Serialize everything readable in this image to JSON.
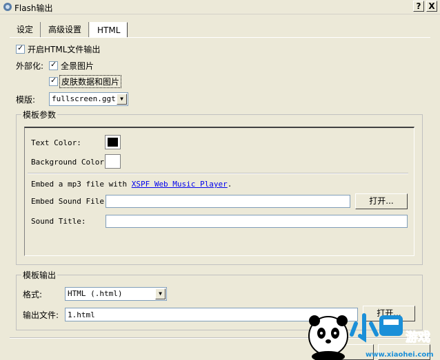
{
  "window": {
    "title": "Flash输出",
    "help_label": "?",
    "close_label": "X"
  },
  "tabs": [
    {
      "label": "设定"
    },
    {
      "label": "高级设置"
    },
    {
      "label": "HTML"
    }
  ],
  "options": {
    "enable_html": {
      "label": "开启HTML文件输出",
      "checked": true
    },
    "externalize": {
      "label": "外部化:"
    },
    "panorama": {
      "label": "全景图片",
      "checked": true
    },
    "skin": {
      "label": "皮肤数据和图片",
      "checked": true
    }
  },
  "template": {
    "label": "模版:",
    "value": "fullscreen.ggt"
  },
  "params": {
    "legend": "模板参数",
    "text_color_label": "Text Color:",
    "text_color": "#000000",
    "bg_color_label": "Background Color:",
    "bg_color": "#ffffff",
    "embed_prefix": "Embed a mp3 file with ",
    "embed_link": "XSPF Web Music Player",
    "embed_suffix": ".",
    "sound_file_label": "Embed Sound File:",
    "sound_file_value": "",
    "open_label": "打开...",
    "sound_title_label": "Sound Title:",
    "sound_title_value": ""
  },
  "output": {
    "legend": "模板输出",
    "format_label": "格式:",
    "format_value": "HTML (.html)",
    "file_label": "输出文件:",
    "file_value": "1.html",
    "open_label": "打开..."
  },
  "watermark": {
    "brand": "小黑游戏",
    "url": "www.xiaohei.com"
  }
}
